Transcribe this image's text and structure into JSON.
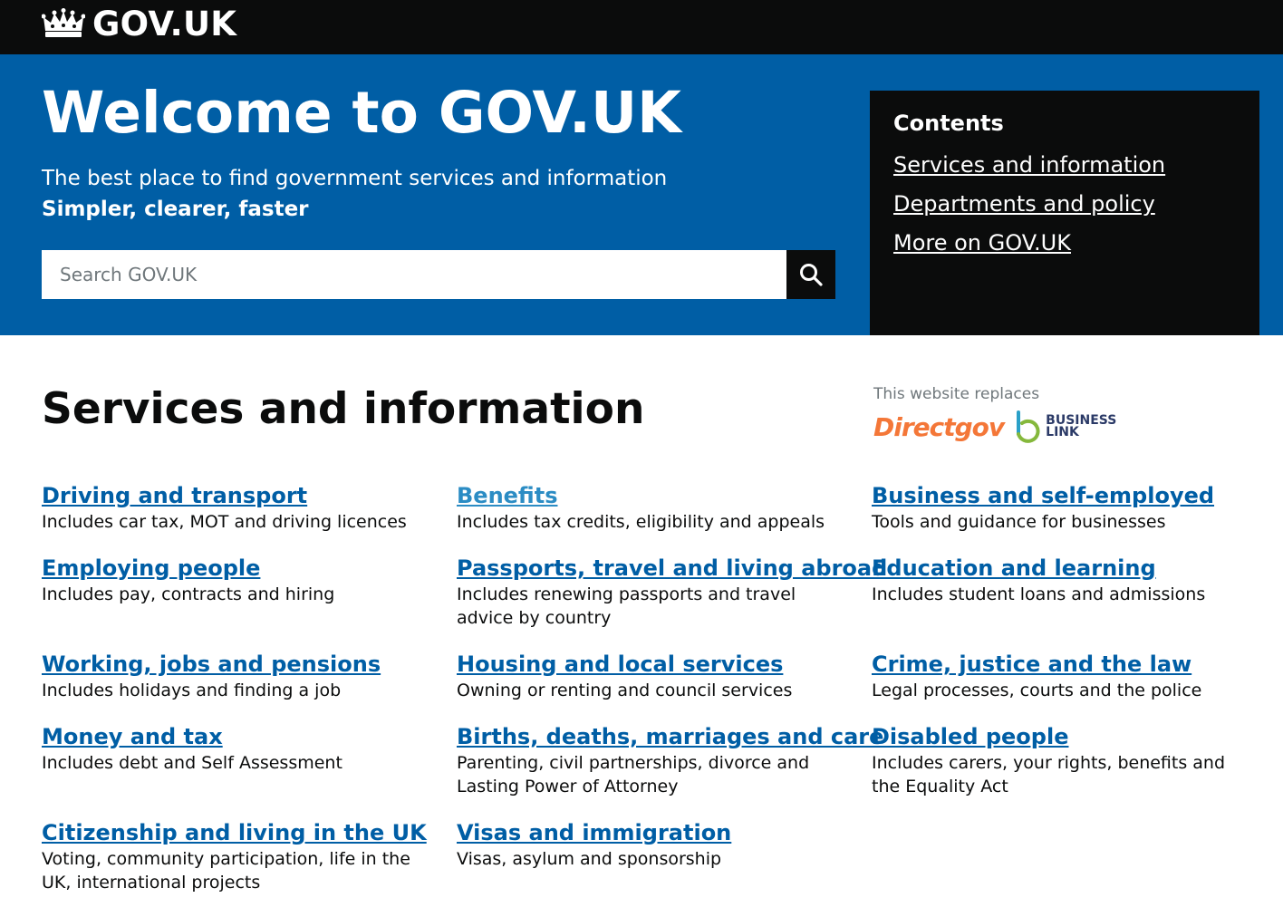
{
  "header": {
    "logo_text": "GOV.UK"
  },
  "hero": {
    "title": "Welcome to GOV.UK",
    "subtitle": "The best place to find government services and information",
    "strapline": "Simpler, clearer, faster",
    "search_placeholder": "Search GOV.UK"
  },
  "contents": {
    "title": "Contents",
    "links": [
      {
        "label": "Services and information"
      },
      {
        "label": "Departments and policy"
      },
      {
        "label": "More on GOV.UK"
      }
    ]
  },
  "services": {
    "title": "Services and information",
    "replaces_label": "This website replaces",
    "directgov": "Directgov",
    "business_link_line1": "BUSINESS",
    "business_link_line2": "LINK",
    "items": [
      {
        "label": "Driving and transport",
        "desc": "Includes car tax, MOT and driving licences"
      },
      {
        "label": "Benefits",
        "desc": "Includes tax credits, eligibility and appeals"
      },
      {
        "label": "Business and self-employed",
        "desc": "Tools and guidance for businesses"
      },
      {
        "label": "Employing people",
        "desc": "Includes pay, contracts and hiring"
      },
      {
        "label": "Passports, travel and living abroad",
        "desc": "Includes renewing passports and travel advice by country"
      },
      {
        "label": "Education and learning",
        "desc": "Includes student loans and admissions"
      },
      {
        "label": "Working, jobs and pensions",
        "desc": "Includes holidays and finding a job"
      },
      {
        "label": "Housing and local services",
        "desc": "Owning or renting and council services"
      },
      {
        "label": "Crime, justice and the law",
        "desc": "Legal processes, courts and the police"
      },
      {
        "label": "Money and tax",
        "desc": "Includes debt and Self Assessment"
      },
      {
        "label": "Births, deaths, marriages and care",
        "desc": "Parenting, civil partnerships, divorce and Lasting Power of Attorney"
      },
      {
        "label": "Disabled people",
        "desc": "Includes carers, your rights, benefits and the Equality Act"
      },
      {
        "label": "Citizenship and living in the UK",
        "desc": "Voting, community participation, life in the UK, international projects"
      },
      {
        "label": "Visas and immigration",
        "desc": "Visas, asylum and sponsorship"
      }
    ]
  },
  "colors": {
    "header_bg": "#0b0c0c",
    "hero_bg": "#005ea5",
    "link": "#005ea5",
    "visited_link": "#2b8cc4",
    "directgov_orange": "#f47738"
  }
}
